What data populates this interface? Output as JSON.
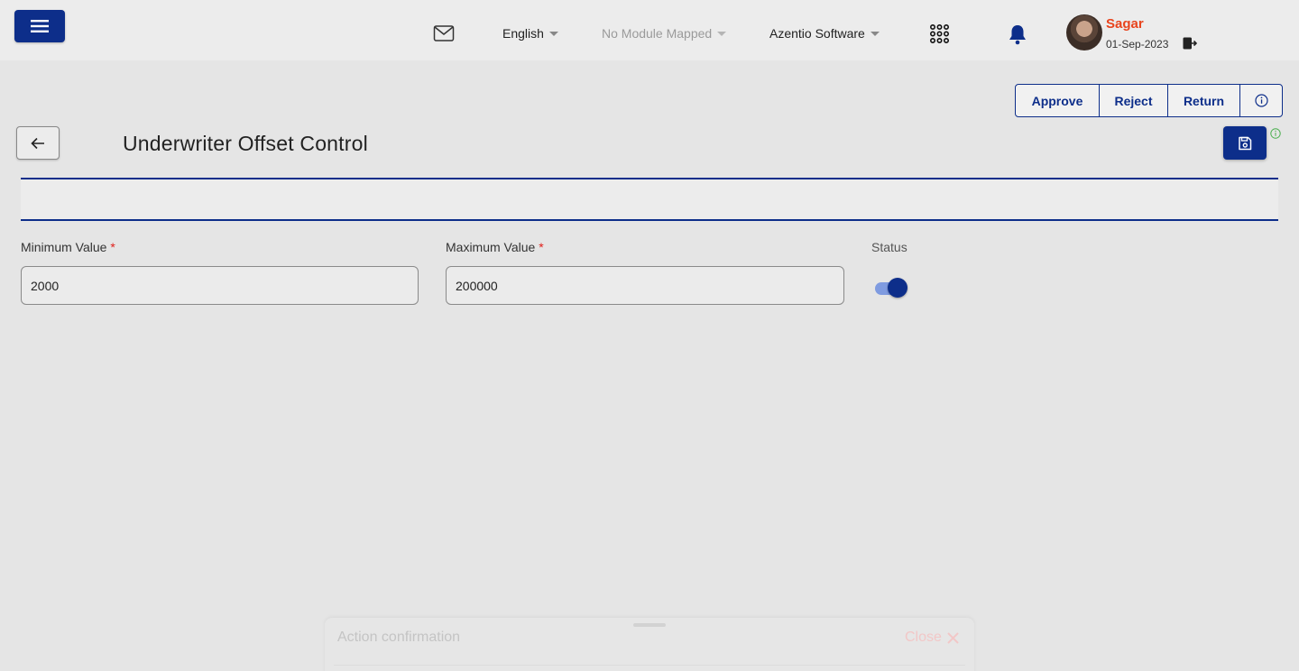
{
  "header": {
    "language": "English",
    "module": "No Module Mapped",
    "organization": "Azentio Software",
    "user_name": "Sagar",
    "user_date": "01-Sep-2023"
  },
  "actions": {
    "approve": "Approve",
    "reject": "Reject",
    "return": "Return"
  },
  "page": {
    "title": "Underwriter Offset Control"
  },
  "form": {
    "min_label": "Minimum Value",
    "min_value": "2000",
    "max_label": "Maximum Value",
    "max_value": "200000",
    "required_marker": "*",
    "status_label": "Status",
    "status_on": true
  },
  "sheet": {
    "title": "Action confirmation",
    "close_label": "Close"
  },
  "colors": {
    "primary": "#0d2e8a",
    "user_name": "#e8441d",
    "required": "#e0201b"
  }
}
